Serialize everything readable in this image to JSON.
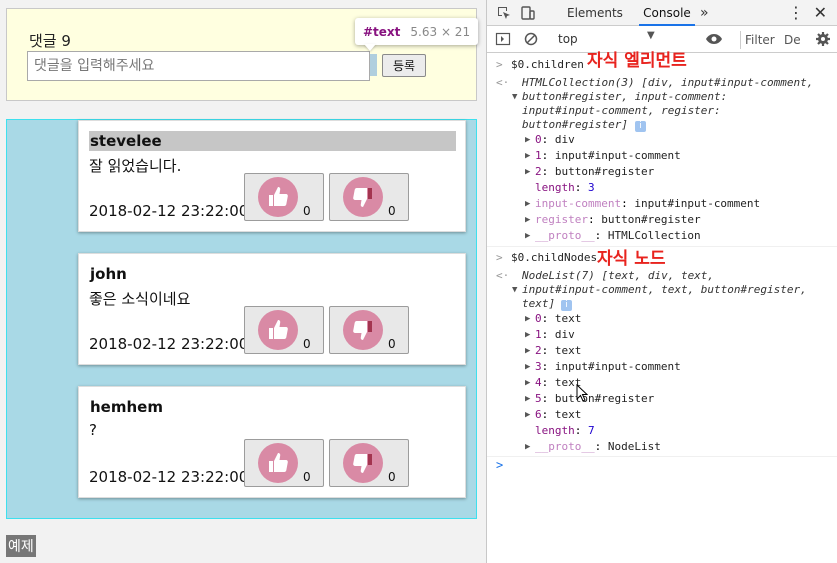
{
  "form": {
    "count_label": "댓글 9",
    "input_placeholder": "댓글을 입력해주세요",
    "register_label": "등록"
  },
  "tooltip": {
    "node": "#text",
    "size": "5.63 × 21"
  },
  "comments": [
    {
      "author": "stevelee",
      "text": "잘 읽었습니다.",
      "date": "2018-02-12 23:22:00",
      "likes": "0",
      "dislikes": "0"
    },
    {
      "author": "john",
      "text": "좋은 소식이네요",
      "date": "2018-02-12 23:22:00",
      "likes": "0",
      "dislikes": "0"
    },
    {
      "author": "hemhem",
      "text": "?",
      "date": "2018-02-12 23:22:00",
      "likes": "0",
      "dislikes": "0"
    }
  ],
  "example_label": "예제",
  "devtools": {
    "tabs": {
      "elements": "Elements",
      "console": "Console",
      "more": "»"
    },
    "toolbar": {
      "context": "top",
      "filter": "Filter",
      "level": "De"
    },
    "annotations": {
      "children": "자식 엘리먼트",
      "nodes": "자식 노드"
    },
    "children_block": {
      "command": "$0.children",
      "summary1": "HTMLCollection(3) [div, input#input-comment,",
      "summary2": "button#register, input-comment:",
      "summary3": "input#input-comment, register:",
      "summary4": "button#register]",
      "rows": [
        {
          "key": "0",
          "value": "div"
        },
        {
          "key": "1",
          "value": "input#input-comment"
        },
        {
          "key": "2",
          "value": "button#register"
        }
      ],
      "length_key": "length",
      "length_value": "3",
      "named": [
        {
          "key": "input-comment",
          "value": "input#input-comment"
        },
        {
          "key": "register",
          "value": "button#register"
        }
      ],
      "proto_key": "__proto__",
      "proto_value": "HTMLCollection"
    },
    "nodes_block": {
      "command": "$0.childNodes",
      "summary1": "NodeList(7) [text, div, text,",
      "summary2": "input#input-comment, text, button#register,",
      "summary3": "text]",
      "rows": [
        {
          "key": "0",
          "value": "text"
        },
        {
          "key": "1",
          "value": "div"
        },
        {
          "key": "2",
          "value": "text"
        },
        {
          "key": "3",
          "value": "input#input-comment"
        },
        {
          "key": "4",
          "value": "text"
        },
        {
          "key": "5",
          "value": "button#register"
        },
        {
          "key": "6",
          "value": "text"
        }
      ],
      "length_key": "length",
      "length_value": "7",
      "proto_key": "__proto__",
      "proto_value": "NodeList"
    }
  }
}
